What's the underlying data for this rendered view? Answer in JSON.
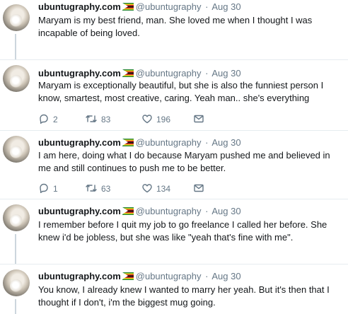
{
  "tweets": [
    {
      "name": "ubuntugraphy.com",
      "handle": "@ubuntugraphy",
      "dot": "·",
      "time": "Aug 30",
      "text": "Maryam is my best friend, man. She loved me when I thought I was incapable of being loved."
    },
    {
      "name": "ubuntugraphy.com",
      "handle": "@ubuntugraphy",
      "dot": "·",
      "time": "Aug 30",
      "text": "Maryam is exceptionally beautiful, but she is also the funniest person I know, smartest, most creative, caring. Yeah man.. she's everything",
      "replies": "2",
      "retweets": "83",
      "likes": "196"
    },
    {
      "name": "ubuntugraphy.com",
      "handle": "@ubuntugraphy",
      "dot": "·",
      "time": "Aug 30",
      "text": "I am here, doing what I do because Maryam pushed me and believed in me and still continues to push me to be better.",
      "replies": "1",
      "retweets": "63",
      "likes": "134"
    },
    {
      "name": "ubuntugraphy.com",
      "handle": "@ubuntugraphy",
      "dot": "·",
      "time": "Aug 30",
      "text": "I remember before I quit my job to go freelance I called her before. She knew i'd be jobless, but she was like \"yeah that's fine with me\"."
    },
    {
      "name": "ubuntugraphy.com",
      "handle": "@ubuntugraphy",
      "dot": "·",
      "time": "Aug 30",
      "text": "You know, I already knew I wanted to marry her yeah. But it's then that I thought if I don't, i'm the biggest mug going."
    }
  ],
  "icons": {
    "reply": "reply-icon",
    "retweet": "retweet-icon",
    "like": "heart-icon",
    "dm": "envelope-icon",
    "flag": "zimbabwe-flag-emoji"
  },
  "colors": {
    "text": "#14171a",
    "muted": "#657786",
    "thread_line": "#ccd6dd",
    "separator": "#e6ecf0"
  }
}
